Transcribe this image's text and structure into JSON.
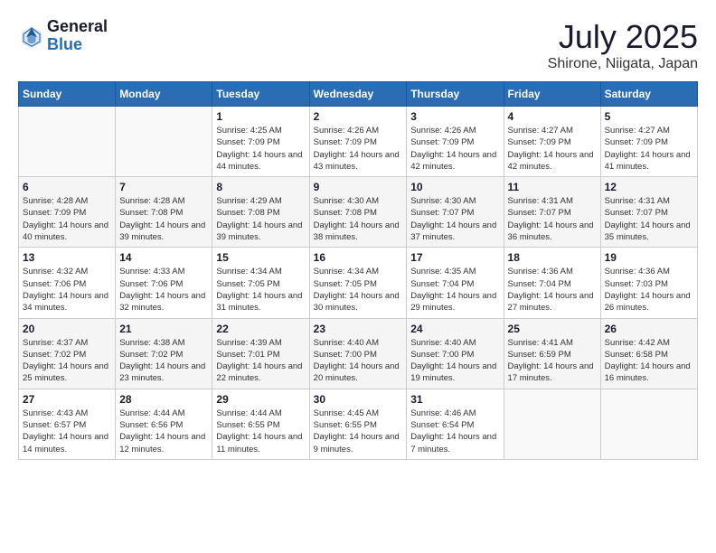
{
  "header": {
    "logo_general": "General",
    "logo_blue": "Blue",
    "month_title": "July 2025",
    "location": "Shirone, Niigata, Japan"
  },
  "weekdays": [
    "Sunday",
    "Monday",
    "Tuesday",
    "Wednesday",
    "Thursday",
    "Friday",
    "Saturday"
  ],
  "weeks": [
    [
      {
        "day": "",
        "info": ""
      },
      {
        "day": "",
        "info": ""
      },
      {
        "day": "1",
        "info": "Sunrise: 4:25 AM\nSunset: 7:09 PM\nDaylight: 14 hours and 44 minutes."
      },
      {
        "day": "2",
        "info": "Sunrise: 4:26 AM\nSunset: 7:09 PM\nDaylight: 14 hours and 43 minutes."
      },
      {
        "day": "3",
        "info": "Sunrise: 4:26 AM\nSunset: 7:09 PM\nDaylight: 14 hours and 42 minutes."
      },
      {
        "day": "4",
        "info": "Sunrise: 4:27 AM\nSunset: 7:09 PM\nDaylight: 14 hours and 42 minutes."
      },
      {
        "day": "5",
        "info": "Sunrise: 4:27 AM\nSunset: 7:09 PM\nDaylight: 14 hours and 41 minutes."
      }
    ],
    [
      {
        "day": "6",
        "info": "Sunrise: 4:28 AM\nSunset: 7:09 PM\nDaylight: 14 hours and 40 minutes."
      },
      {
        "day": "7",
        "info": "Sunrise: 4:28 AM\nSunset: 7:08 PM\nDaylight: 14 hours and 39 minutes."
      },
      {
        "day": "8",
        "info": "Sunrise: 4:29 AM\nSunset: 7:08 PM\nDaylight: 14 hours and 39 minutes."
      },
      {
        "day": "9",
        "info": "Sunrise: 4:30 AM\nSunset: 7:08 PM\nDaylight: 14 hours and 38 minutes."
      },
      {
        "day": "10",
        "info": "Sunrise: 4:30 AM\nSunset: 7:07 PM\nDaylight: 14 hours and 37 minutes."
      },
      {
        "day": "11",
        "info": "Sunrise: 4:31 AM\nSunset: 7:07 PM\nDaylight: 14 hours and 36 minutes."
      },
      {
        "day": "12",
        "info": "Sunrise: 4:31 AM\nSunset: 7:07 PM\nDaylight: 14 hours and 35 minutes."
      }
    ],
    [
      {
        "day": "13",
        "info": "Sunrise: 4:32 AM\nSunset: 7:06 PM\nDaylight: 14 hours and 34 minutes."
      },
      {
        "day": "14",
        "info": "Sunrise: 4:33 AM\nSunset: 7:06 PM\nDaylight: 14 hours and 32 minutes."
      },
      {
        "day": "15",
        "info": "Sunrise: 4:34 AM\nSunset: 7:05 PM\nDaylight: 14 hours and 31 minutes."
      },
      {
        "day": "16",
        "info": "Sunrise: 4:34 AM\nSunset: 7:05 PM\nDaylight: 14 hours and 30 minutes."
      },
      {
        "day": "17",
        "info": "Sunrise: 4:35 AM\nSunset: 7:04 PM\nDaylight: 14 hours and 29 minutes."
      },
      {
        "day": "18",
        "info": "Sunrise: 4:36 AM\nSunset: 7:04 PM\nDaylight: 14 hours and 27 minutes."
      },
      {
        "day": "19",
        "info": "Sunrise: 4:36 AM\nSunset: 7:03 PM\nDaylight: 14 hours and 26 minutes."
      }
    ],
    [
      {
        "day": "20",
        "info": "Sunrise: 4:37 AM\nSunset: 7:02 PM\nDaylight: 14 hours and 25 minutes."
      },
      {
        "day": "21",
        "info": "Sunrise: 4:38 AM\nSunset: 7:02 PM\nDaylight: 14 hours and 23 minutes."
      },
      {
        "day": "22",
        "info": "Sunrise: 4:39 AM\nSunset: 7:01 PM\nDaylight: 14 hours and 22 minutes."
      },
      {
        "day": "23",
        "info": "Sunrise: 4:40 AM\nSunset: 7:00 PM\nDaylight: 14 hours and 20 minutes."
      },
      {
        "day": "24",
        "info": "Sunrise: 4:40 AM\nSunset: 7:00 PM\nDaylight: 14 hours and 19 minutes."
      },
      {
        "day": "25",
        "info": "Sunrise: 4:41 AM\nSunset: 6:59 PM\nDaylight: 14 hours and 17 minutes."
      },
      {
        "day": "26",
        "info": "Sunrise: 4:42 AM\nSunset: 6:58 PM\nDaylight: 14 hours and 16 minutes."
      }
    ],
    [
      {
        "day": "27",
        "info": "Sunrise: 4:43 AM\nSunset: 6:57 PM\nDaylight: 14 hours and 14 minutes."
      },
      {
        "day": "28",
        "info": "Sunrise: 4:44 AM\nSunset: 6:56 PM\nDaylight: 14 hours and 12 minutes."
      },
      {
        "day": "29",
        "info": "Sunrise: 4:44 AM\nSunset: 6:55 PM\nDaylight: 14 hours and 11 minutes."
      },
      {
        "day": "30",
        "info": "Sunrise: 4:45 AM\nSunset: 6:55 PM\nDaylight: 14 hours and 9 minutes."
      },
      {
        "day": "31",
        "info": "Sunrise: 4:46 AM\nSunset: 6:54 PM\nDaylight: 14 hours and 7 minutes."
      },
      {
        "day": "",
        "info": ""
      },
      {
        "day": "",
        "info": ""
      }
    ]
  ]
}
